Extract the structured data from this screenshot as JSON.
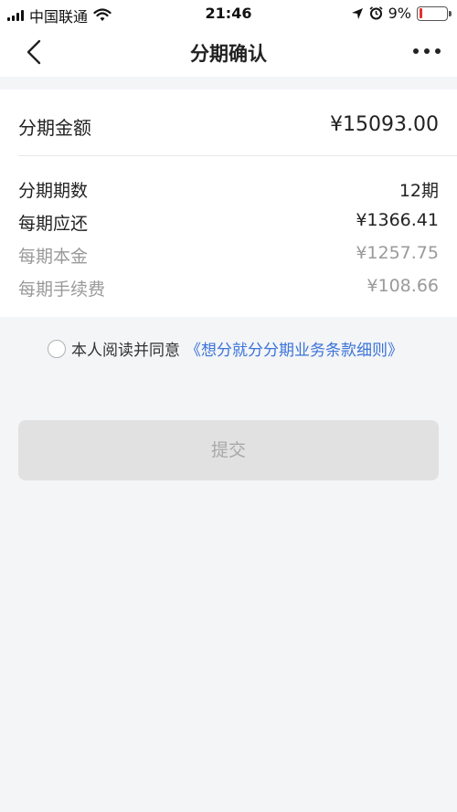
{
  "status_bar": {
    "carrier": "中国联通",
    "time": "21:46",
    "battery_percent": "9%",
    "battery_level": 0.09,
    "battery_color": "#e5322d",
    "icons": [
      "signal-icon",
      "wifi-icon",
      "location-icon",
      "alarm-icon",
      "battery-icon"
    ]
  },
  "nav": {
    "title": "分期确认",
    "back_icon": "chevron-left-icon",
    "more_icon": "more-dots-icon"
  },
  "summary": {
    "amount_label": "分期金额",
    "amount_value": "¥15093.00",
    "rows": [
      {
        "label": "分期期数",
        "value": "12期"
      },
      {
        "label": "每期应还",
        "value": "¥1366.41"
      },
      {
        "label": "每期本金",
        "value": "¥1257.75"
      },
      {
        "label": "每期手续费",
        "value": "¥108.66"
      }
    ]
  },
  "agreement": {
    "prefix": "本人阅读并同意",
    "link": "《想分就分分期业务条款细则》",
    "link_color": "#3a73d8"
  },
  "submit": {
    "label": "提交"
  }
}
